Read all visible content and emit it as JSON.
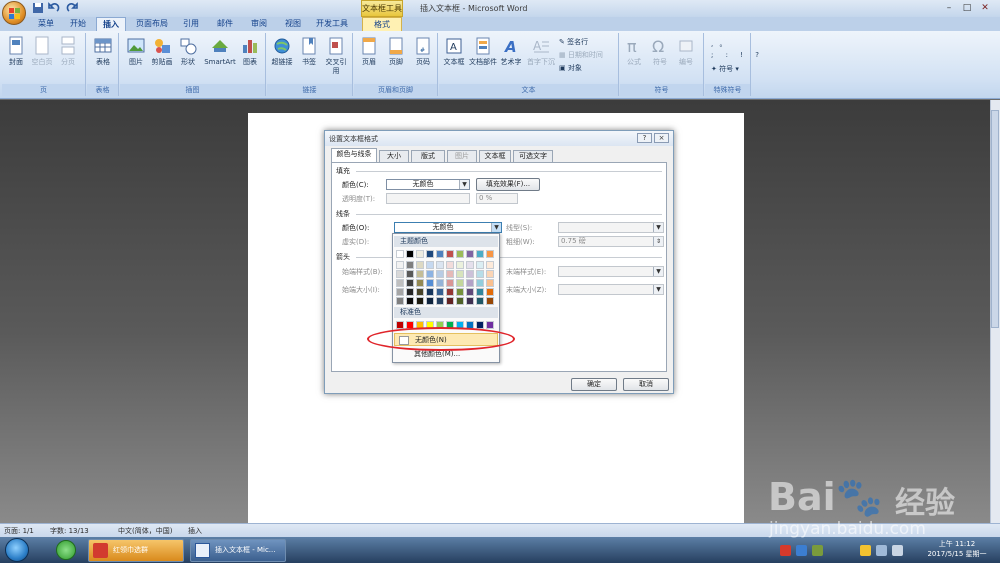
{
  "window": {
    "title": "插入文本框 - Microsoft Word",
    "contextual_tab_title": "文本框工具"
  },
  "ribbon_tabs": [
    "菜单",
    "开始",
    "插入",
    "页面布局",
    "引用",
    "邮件",
    "审阅",
    "视图",
    "开发工具",
    "格式"
  ],
  "active_tab": "插入",
  "ribbon": {
    "groups": {
      "page": {
        "label": "页",
        "buttons": [
          "封面",
          "空白页",
          "分页"
        ]
      },
      "table": {
        "label": "表格",
        "buttons": [
          "表格"
        ]
      },
      "illustrations": {
        "label": "插图",
        "buttons": [
          "图片",
          "剪贴画",
          "形状",
          "SmartArt",
          "图表"
        ]
      },
      "links": {
        "label": "链接",
        "buttons": [
          "超链接",
          "书签",
          "交叉引用"
        ]
      },
      "header_footer": {
        "label": "页眉和页脚",
        "buttons": [
          "页眉",
          "页脚",
          "页码"
        ]
      },
      "text": {
        "label": "文本",
        "buttons": [
          "文本框",
          "文档部件",
          "艺术字",
          "首字下沉"
        ],
        "small": [
          "签名行",
          "日期和时间",
          "对象"
        ]
      },
      "symbols": {
        "label": "符号",
        "buttons": [
          "公式",
          "符号",
          "编号"
        ]
      },
      "special": {
        "label": "特殊符号",
        "items": [
          ",",
          "。",
          ";",
          ":",
          "!",
          "?"
        ],
        "dropdown": "符号"
      }
    }
  },
  "dialog": {
    "title": "设置文本框格式",
    "help": "?",
    "close": "×",
    "tabs": [
      "颜色与线条",
      "大小",
      "版式",
      "图片",
      "文本框",
      "可选文字"
    ],
    "active_tab": "颜色与线条",
    "fill": {
      "section": "填充",
      "color_label": "颜色(C):",
      "color_value": "无颜色",
      "effects_button": "填充效果(F)...",
      "transparency_label": "透明度(T):",
      "transparency_value": "0 %"
    },
    "line": {
      "section": "线条",
      "color_label": "颜色(O):",
      "color_value": "无颜色",
      "dash_label": "虚实(D):",
      "style_label": "线型(S):",
      "weight_label": "粗细(W):",
      "weight_value": "0.75 磅"
    },
    "arrows": {
      "section": "箭头",
      "begin_style": "始端样式(B):",
      "end_style": "末端样式(E):",
      "begin_size": "始端大小(I):",
      "end_size": "末端大小(Z):"
    },
    "ok": "确定",
    "cancel": "取消"
  },
  "color_menu": {
    "theme_header": "主题颜色",
    "standard_header": "标准色",
    "no_color": "无颜色(N)",
    "more_colors": "其他颜色(M)...",
    "theme_top": [
      "#ffffff",
      "#000000",
      "#eeece1",
      "#1f497d",
      "#4f81bd",
      "#c0504d",
      "#9bbb59",
      "#8064a2",
      "#4bacc6",
      "#f79646"
    ],
    "theme_tints": [
      [
        "#f2f2f2",
        "#7f7f7f",
        "#ddd9c3",
        "#c6d9f0",
        "#dbe5f1",
        "#f2dcdb",
        "#ebf1dd",
        "#e5e0ec",
        "#dbeef3",
        "#fdeada"
      ],
      [
        "#d8d8d8",
        "#595959",
        "#c4bd97",
        "#8db3e2",
        "#b8cce4",
        "#e5b9b7",
        "#d7e3bc",
        "#ccc1d9",
        "#b7dde8",
        "#fbd5b5"
      ],
      [
        "#bfbfbf",
        "#3f3f3f",
        "#938953",
        "#548dd4",
        "#95b3d7",
        "#d99694",
        "#c3d69b",
        "#b2a2c7",
        "#92cddc",
        "#fac08f"
      ],
      [
        "#a5a5a5",
        "#262626",
        "#494429",
        "#17365d",
        "#366092",
        "#953734",
        "#76923c",
        "#5f497a",
        "#31859b",
        "#e36c09"
      ],
      [
        "#7f7f7f",
        "#0c0c0c",
        "#1d1b10",
        "#0f243e",
        "#244061",
        "#632423",
        "#4f6128",
        "#3f3151",
        "#205867",
        "#974806"
      ]
    ],
    "standard": [
      "#c00000",
      "#ff0000",
      "#ffc000",
      "#ffff00",
      "#92d050",
      "#00b050",
      "#00b0f0",
      "#0070c0",
      "#002060",
      "#7030a0"
    ]
  },
  "statusbar": {
    "page": "页面: 1/1",
    "words": "字数: 13/13",
    "language": "中文(简体，中国)",
    "mode": "插入"
  },
  "taskbar": {
    "items": [
      "红领巾选群",
      "插入文本框 - Mic..."
    ],
    "clock_time": "上午 11:12",
    "clock_date": "2017/5/15 星期一"
  },
  "watermark": {
    "brand": "Bai",
    "brand2": "经验",
    "url": "jingyan.baidu.com"
  },
  "colors": {
    "annotation_circle": "#e0242a",
    "ribbon_accent": "#15428b"
  }
}
